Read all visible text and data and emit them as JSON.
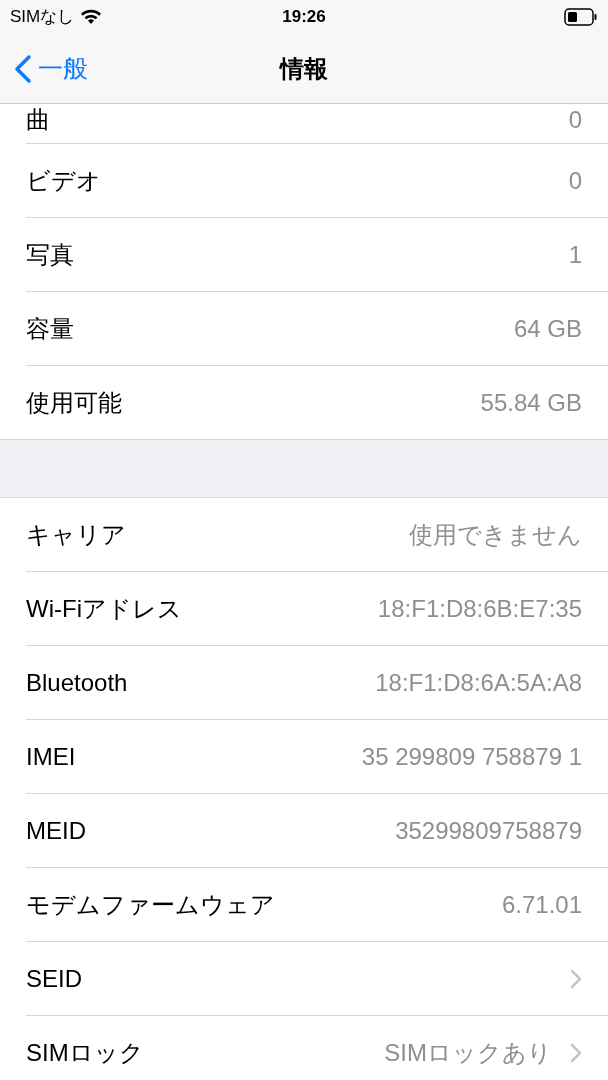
{
  "status_bar": {
    "carrier": "SIMなし",
    "time": "19:26"
  },
  "nav": {
    "back": "一般",
    "title": "情報"
  },
  "sections": [
    {
      "rows": [
        {
          "kind": "cut",
          "label": "曲",
          "value": "0",
          "disclosure": false
        },
        {
          "kind": "full",
          "label": "ビデオ",
          "value": "0",
          "disclosure": false
        },
        {
          "kind": "full",
          "label": "写真",
          "value": "1",
          "disclosure": false
        },
        {
          "kind": "full",
          "label": "容量",
          "value": "64 GB",
          "disclosure": false
        },
        {
          "kind": "full",
          "label": "使用可能",
          "value": "55.84 GB",
          "disclosure": false
        }
      ]
    },
    {
      "rows": [
        {
          "kind": "full",
          "label": "キャリア",
          "value": "使用できません",
          "disclosure": false
        },
        {
          "kind": "full",
          "label": "Wi-Fiアドレス",
          "value": "18:F1:D8:6B:E7:35",
          "disclosure": false
        },
        {
          "kind": "full",
          "label": "Bluetooth",
          "value": "18:F1:D8:6A:5A:A8",
          "disclosure": false
        },
        {
          "kind": "full",
          "label": "IMEI",
          "value": "35 299809 758879 1",
          "disclosure": false
        },
        {
          "kind": "full",
          "label": "MEID",
          "value": "35299809758879",
          "disclosure": false
        },
        {
          "kind": "full",
          "label": "モデムファームウェア",
          "value": "6.71.01",
          "disclosure": false
        },
        {
          "kind": "full",
          "label": "SEID",
          "disclosure": true
        },
        {
          "kind": "full",
          "label": "SIMロック",
          "value": "SIMロックあり",
          "disclosure": true
        }
      ]
    }
  ]
}
